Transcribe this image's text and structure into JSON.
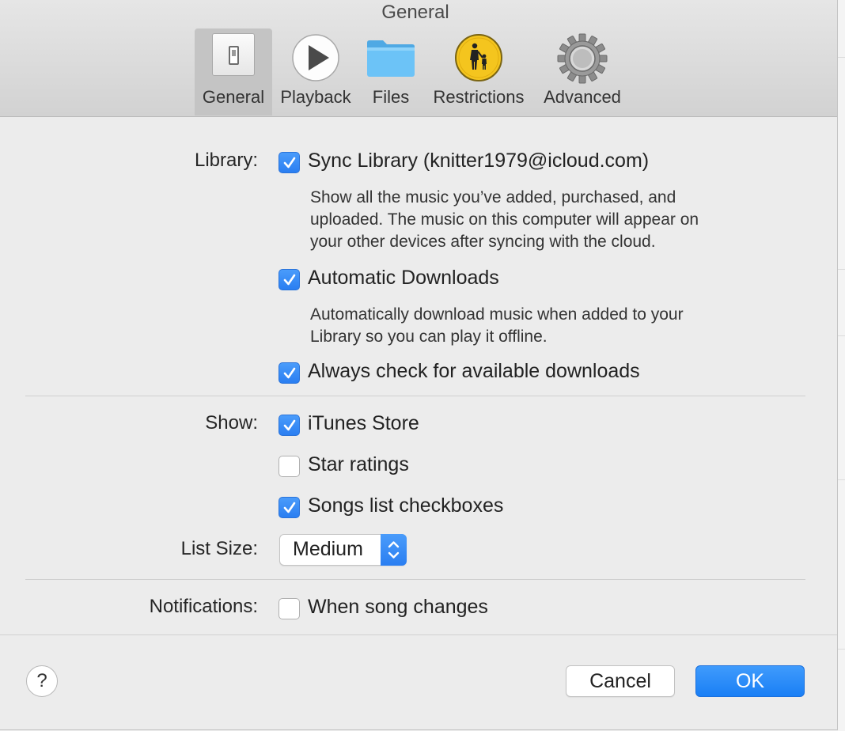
{
  "window": {
    "title": "General"
  },
  "toolbar": {
    "tabs": [
      {
        "label": "General",
        "icon": "switch-icon",
        "selected": true
      },
      {
        "label": "Playback",
        "icon": "play-icon",
        "selected": false
      },
      {
        "label": "Files",
        "icon": "folder-icon",
        "selected": false
      },
      {
        "label": "Restrictions",
        "icon": "parental-controls-icon",
        "selected": false
      },
      {
        "label": "Advanced",
        "icon": "gear-icon",
        "selected": false
      }
    ]
  },
  "library": {
    "label": "Library:",
    "sync_library": {
      "label": "Sync Library (knitter1979@icloud.com)",
      "checked": true
    },
    "sync_description": [
      "Show all the music you’ve added, purchased, and",
      "uploaded. The music on this computer will appear on",
      "your other devices after syncing with the cloud."
    ],
    "automatic_downloads": {
      "label": "Automatic Downloads",
      "checked": true
    },
    "downloads_description": [
      "Automatically download music when added to your",
      "Library so you can play it offline."
    ],
    "always_check": {
      "label": "Always check for available downloads",
      "checked": true
    }
  },
  "show": {
    "label": "Show:",
    "itunes_store": {
      "label": "iTunes Store",
      "checked": true
    },
    "star_ratings": {
      "label": "Star ratings",
      "checked": false
    },
    "songs_list_checkboxes": {
      "label": "Songs list checkboxes",
      "checked": true
    }
  },
  "list_size": {
    "label": "List Size:",
    "value": "Medium"
  },
  "notifications": {
    "label": "Notifications:",
    "when_song_changes": {
      "label": "When song changes",
      "checked": false
    }
  },
  "footer": {
    "help_label": "?",
    "cancel_label": "Cancel",
    "ok_label": "OK"
  },
  "colors": {
    "accent": "#2a7ef1",
    "toolbar_bg": "#d8d8d8",
    "window_bg": "#ececec",
    "folder": "#5bbcf5",
    "restrictions_yellow": "#f4c51e"
  }
}
